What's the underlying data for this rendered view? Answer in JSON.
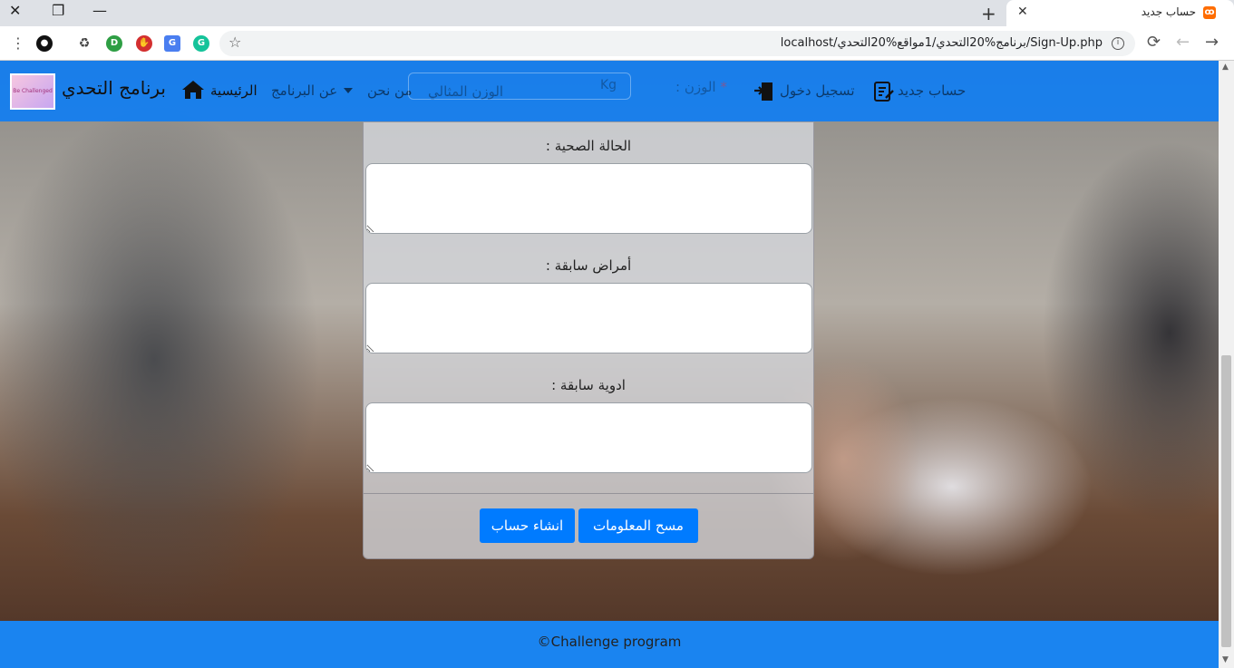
{
  "browser": {
    "tab_title": "حساب جديد",
    "tab_favicon": "xampp-favicon-icon",
    "url": "localhost/برنامج%20التحدي/1مواقع%20التحدي/Sign-Up.php",
    "new_tab_label": "+",
    "tab_close_label": "✕",
    "window_controls": {
      "close": "✕",
      "restore": "❐",
      "minimize": "—"
    }
  },
  "navbar": {
    "brand": "برنامج التحدي",
    "logo_caption": "Be Challenged",
    "links": {
      "home": "الرئيسية",
      "about_program": "عن البرنامج",
      "about_us": "من نحن",
      "login": "تسجيل دخول",
      "signup": "حساب جديد"
    }
  },
  "form": {
    "weight_label": "الوزن :",
    "weight_required_mark": "*",
    "ideal_weight_placeholder": "الوزن المثالي",
    "weight_unit": "Kg",
    "health_status_label": "الحالة الصحية :",
    "health_status_value": "",
    "previous_diseases_label": "أمراض سابقة :",
    "previous_diseases_value": "",
    "previous_medications_label": "ادوية سابقة :",
    "previous_medications_value": "",
    "clear_button": "مسح المعلومات",
    "submit_button": "انشاء حساب"
  },
  "footer": {
    "text": "©Challenge program"
  },
  "colors": {
    "navbar": "#007bff",
    "button": "#007bff",
    "footer": "#1a84f0"
  }
}
